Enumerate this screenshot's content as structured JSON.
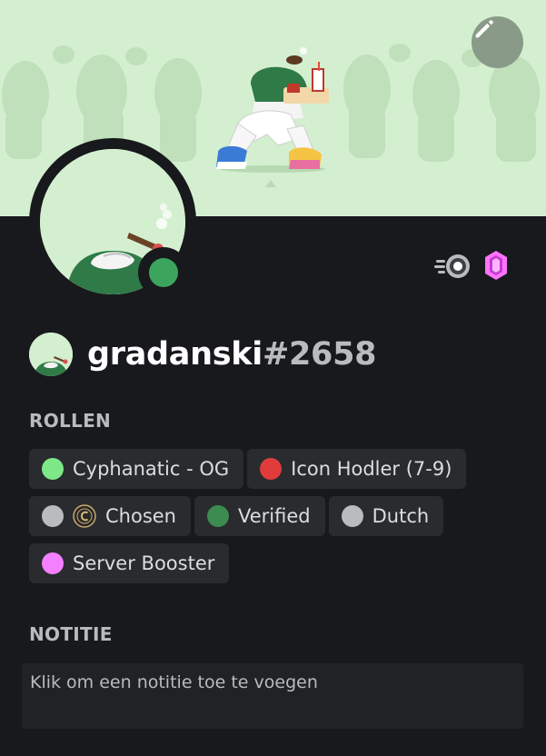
{
  "profile": {
    "username": "gradanski",
    "discriminator": "#2658",
    "status": "online"
  },
  "icons": {
    "edit": "pencil-icon",
    "nitro_badge": "nitro-badge-icon",
    "boost_badge": "server-boost-badge-icon",
    "status": "online-status-icon"
  },
  "roles_section": {
    "title": "ROLLEN",
    "roles": [
      {
        "label": "Cyphanatic - OG",
        "color": "#7ee787",
        "icon": null
      },
      {
        "label": "Icon Hodler (7-9)",
        "color": "#e03c3c",
        "icon": null
      },
      {
        "label": "Chosen",
        "color": "#b9bbbe",
        "icon": "chosen-emblem-icon"
      },
      {
        "label": "Verified",
        "color": "#3d8c4f",
        "icon": null
      },
      {
        "label": "Dutch",
        "color": "#b9bbbe",
        "icon": null
      },
      {
        "label": "Server Booster",
        "color": "#f47fff",
        "icon": null
      }
    ]
  },
  "note_section": {
    "title": "NOTITIE",
    "placeholder": "Klik om een notitie toe te voegen"
  },
  "colors": {
    "background": "#18191c",
    "banner": "#d4efd0",
    "status_online": "#3ba55d",
    "role_chip": "#292b2f",
    "nitro_purple": "#ff73fa"
  }
}
